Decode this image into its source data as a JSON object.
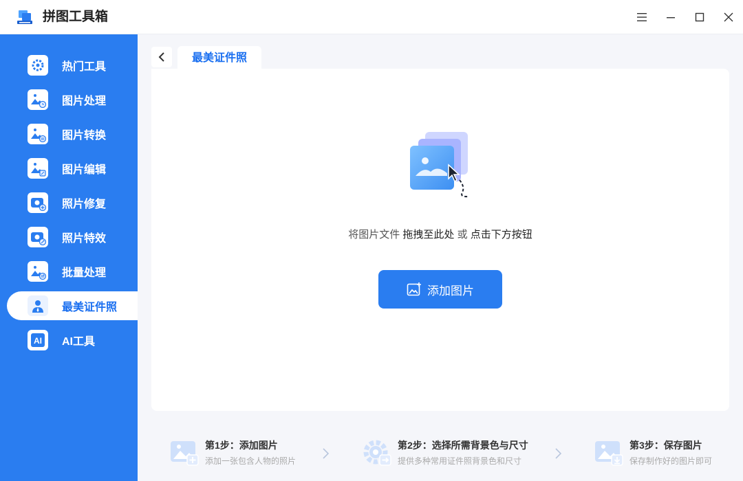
{
  "app": {
    "title": "拼图工具箱"
  },
  "sidebar": {
    "items": [
      {
        "label": "热门工具",
        "icon": "gear-icon",
        "active": false
      },
      {
        "label": "图片处理",
        "icon": "image-clock-icon",
        "active": false
      },
      {
        "label": "图片转换",
        "icon": "image-convert-icon",
        "active": false
      },
      {
        "label": "图片编辑",
        "icon": "image-edit-icon",
        "active": false
      },
      {
        "label": "照片修复",
        "icon": "camera-add-icon",
        "active": false
      },
      {
        "label": "照片特效",
        "icon": "camera-magic-icon",
        "active": false
      },
      {
        "label": "批量处理",
        "icon": "image-batch-icon",
        "active": false
      },
      {
        "label": "最美证件照",
        "icon": "person-id-icon",
        "active": true
      },
      {
        "label": "AI工具",
        "icon": "ai-icon",
        "active": false
      }
    ]
  },
  "tab": {
    "label": "最美证件照"
  },
  "drop": {
    "hint_part1": "将图片文件 ",
    "hint_part2": "拖拽至此处",
    "hint_part3": " 或 ",
    "hint_part4": "点击下方按钮"
  },
  "add_button": {
    "label": "添加图片"
  },
  "steps": [
    {
      "title": "第1步：添加图片",
      "desc": "添加一张包含人物的照片"
    },
    {
      "title": "第2步：选择所需背景色与尺寸",
      "desc": "提供多种常用证件照背景色和尺寸"
    },
    {
      "title": "第3步：保存图片",
      "desc": "保存制作好的图片即可"
    }
  ],
  "colors": {
    "accent": "#2a7df0",
    "active_text": "#1a6ff0",
    "main_bg": "#f5f6fa"
  }
}
